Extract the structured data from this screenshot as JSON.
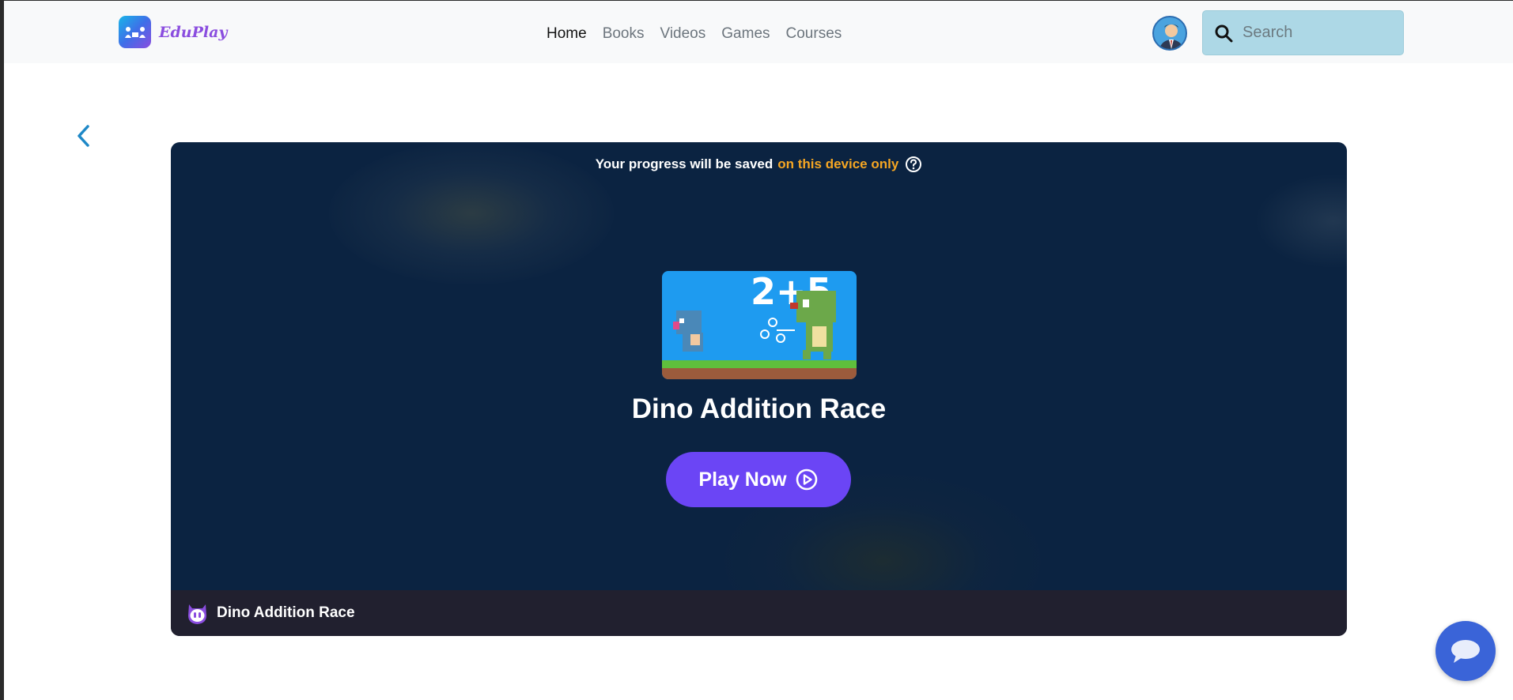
{
  "brand": {
    "name": "EduPlay",
    "logo_icon": "kids-reading-icon"
  },
  "nav": {
    "links": [
      {
        "label": "Home",
        "active": true
      },
      {
        "label": "Books",
        "active": false
      },
      {
        "label": "Videos",
        "active": false
      },
      {
        "label": "Games",
        "active": false
      },
      {
        "label": "Courses",
        "active": false
      }
    ]
  },
  "header": {
    "avatar_icon": "user-avatar-icon",
    "search": {
      "placeholder": "Search",
      "value": ""
    }
  },
  "game": {
    "progress_note": "Your progress will be saved",
    "progress_highlight": "on this device only",
    "title": "Dino Addition Race",
    "thumbnail_text": "2+5",
    "play_label": "Play Now",
    "footer_title": "Dino Addition Race"
  },
  "colors": {
    "accent": "#6b45f5",
    "highlight": "#f5a623",
    "card_bg": "#0b2341",
    "search_bg": "#add8e6",
    "chat_bg": "#3a64d8"
  }
}
